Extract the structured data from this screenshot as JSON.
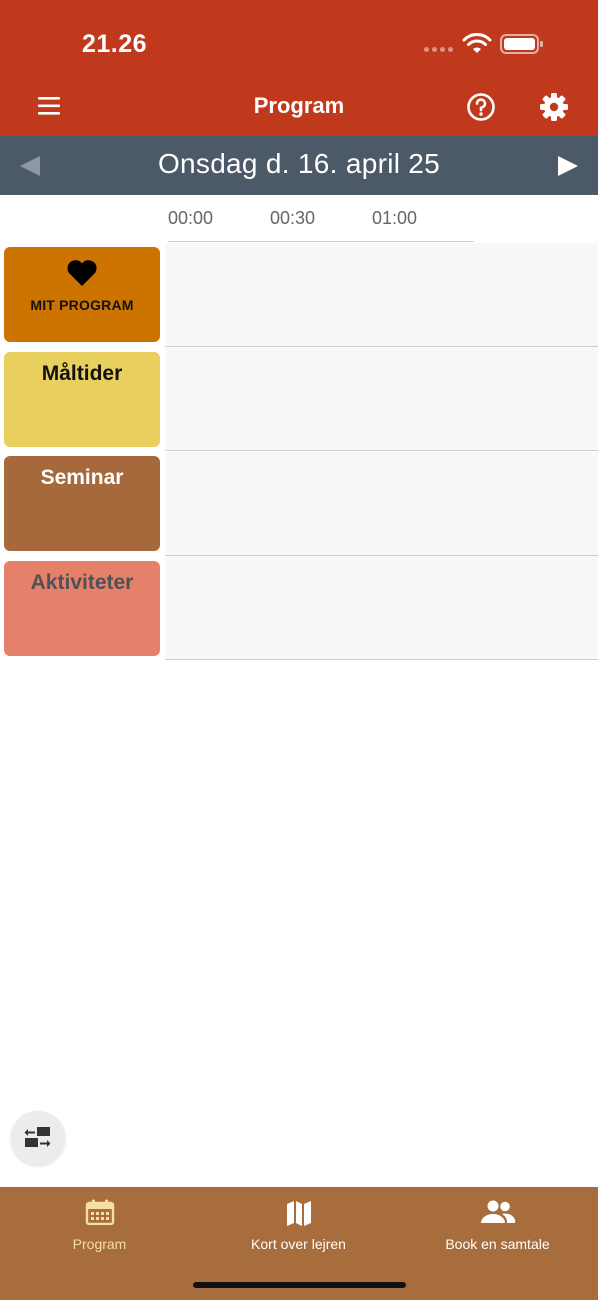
{
  "status_bar": {
    "time": "21.26"
  },
  "header": {
    "title": "Program",
    "menu_icon": "hamburger-icon",
    "help_icon": "help-circle-icon",
    "settings_icon": "gear-icon"
  },
  "date_nav": {
    "label": "Onsdag d. 16. april 25",
    "prev_icon": "triangle-left-icon",
    "next_icon": "triangle-right-icon"
  },
  "timeline": {
    "ticks": [
      "00:00",
      "00:30",
      "01:00"
    ]
  },
  "categories": [
    {
      "label": "MIT PROGRAM",
      "icon": "heart-icon",
      "color": "#cc7300"
    },
    {
      "label": "Måltider",
      "color": "#e8cf5e"
    },
    {
      "label": "Seminar",
      "color": "#a6693b"
    },
    {
      "label": "Aktiviteter",
      "color": "#e5806b"
    }
  ],
  "fab": {
    "icon": "swap-icon"
  },
  "bottom_nav": [
    {
      "label": "Program",
      "icon": "calendar-icon",
      "active": true
    },
    {
      "label": "Kort over lejren",
      "icon": "map-icon"
    },
    {
      "label": "Book en samtale",
      "icon": "people-icon"
    }
  ],
  "colors": {
    "header": "#c0391c",
    "date_bar": "#4b5a66",
    "bottom_nav": "#a86d3d",
    "active_tab": "#f5dfa4"
  }
}
